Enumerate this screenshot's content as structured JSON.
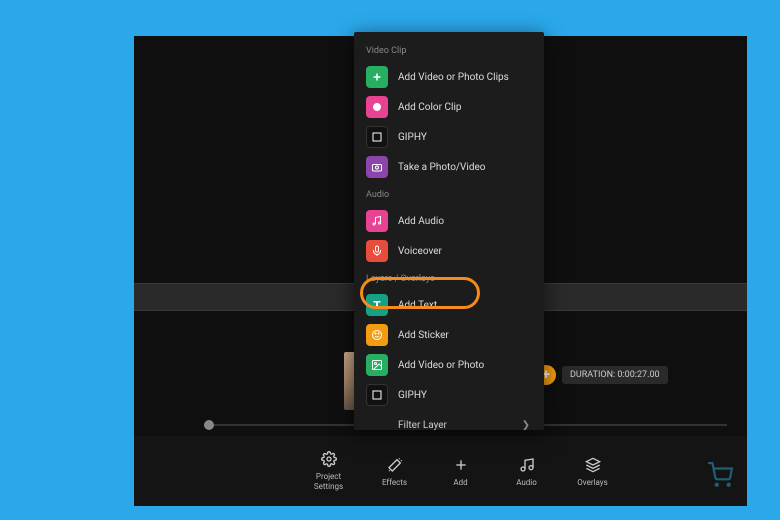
{
  "menu": {
    "sections": {
      "video_clip": {
        "header": "Video Clip",
        "items": {
          "add_video_photo_clips": "Add Video or Photo Clips",
          "add_color_clip": "Add Color Clip",
          "giphy": "GIPHY",
          "take_photo_video": "Take a Photo/Video"
        }
      },
      "audio": {
        "header": "Audio",
        "items": {
          "add_audio": "Add Audio",
          "voiceover": "Voiceover"
        }
      },
      "layers": {
        "header": "Layers / Overlays",
        "items": {
          "add_text": "Add Text",
          "add_sticker": "Add Sticker",
          "add_video_photo": "Add Video or Photo",
          "giphy": "GIPHY"
        }
      }
    },
    "filter_layer": "Filter Layer"
  },
  "toolbar": {
    "project_settings": "Project\nSettings",
    "effects": "Effects",
    "add": "Add",
    "audio": "Audio",
    "overlays": "Overlays"
  },
  "timeline": {
    "duration_label": "DURATION: 0:00:27.00"
  }
}
